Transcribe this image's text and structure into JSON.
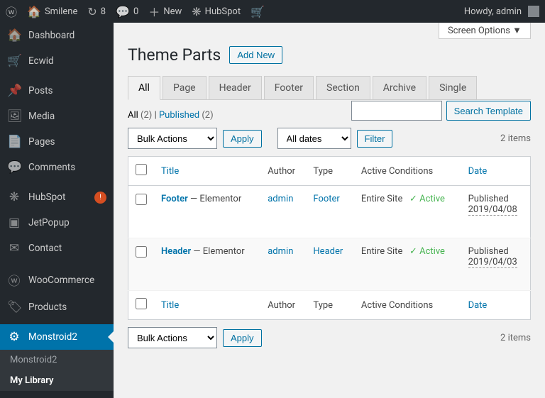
{
  "adminbar": {
    "site": "Smilene",
    "pending": "8",
    "comments": "0",
    "new": "New",
    "hubspot": "HubSpot",
    "howdy": "Howdy, admin"
  },
  "sidebar": {
    "items": [
      {
        "icon": "🏠",
        "label": "Dashboard"
      },
      {
        "icon": "🛒",
        "label": "Ecwid"
      },
      {
        "icon": "📌",
        "label": "Posts"
      },
      {
        "icon": "🖼",
        "label": "Media"
      },
      {
        "icon": "📄",
        "label": "Pages"
      },
      {
        "icon": "💬",
        "label": "Comments"
      },
      {
        "icon": "❋",
        "label": "HubSpot",
        "badge": "!"
      },
      {
        "icon": "▣",
        "label": "JetPopup"
      },
      {
        "icon": "✉",
        "label": "Contact"
      },
      {
        "icon": "ⓦ",
        "label": "WooCommerce"
      },
      {
        "icon": "🏷",
        "label": "Products"
      },
      {
        "icon": "⚙",
        "label": "Monstroid2",
        "current": true
      }
    ],
    "submenu": [
      "Monstroid2",
      "My Library"
    ]
  },
  "page": {
    "title": "Theme Parts",
    "add": "Add New",
    "screen": "Screen Options ▼"
  },
  "tabs": [
    "All",
    "Page",
    "Header",
    "Footer",
    "Section",
    "Archive",
    "Single"
  ],
  "subsub": {
    "all": "All",
    "all_c": "(2)",
    "sep": " | ",
    "pub": "Published",
    "pub_c": "(2)"
  },
  "search": {
    "button": "Search Template"
  },
  "bulk": {
    "label": "Bulk Actions",
    "apply": "Apply"
  },
  "dates": {
    "label": "All dates",
    "filter": "Filter"
  },
  "count": "2 items",
  "cols": {
    "title": "Title",
    "author": "Author",
    "type": "Type",
    "cond": "Active Conditions",
    "date": "Date"
  },
  "rows": [
    {
      "title": "Footer",
      "suffix": " — Elementor",
      "author": "admin",
      "type": "Footer",
      "cond": "Entire Site",
      "status": "✓ Active",
      "pub": "Published",
      "date": "2019/04/08"
    },
    {
      "title": "Header",
      "suffix": " — Elementor",
      "author": "admin",
      "type": "Header",
      "cond": "Entire Site",
      "status": "✓ Active",
      "pub": "Published",
      "date": "2019/04/03"
    }
  ]
}
